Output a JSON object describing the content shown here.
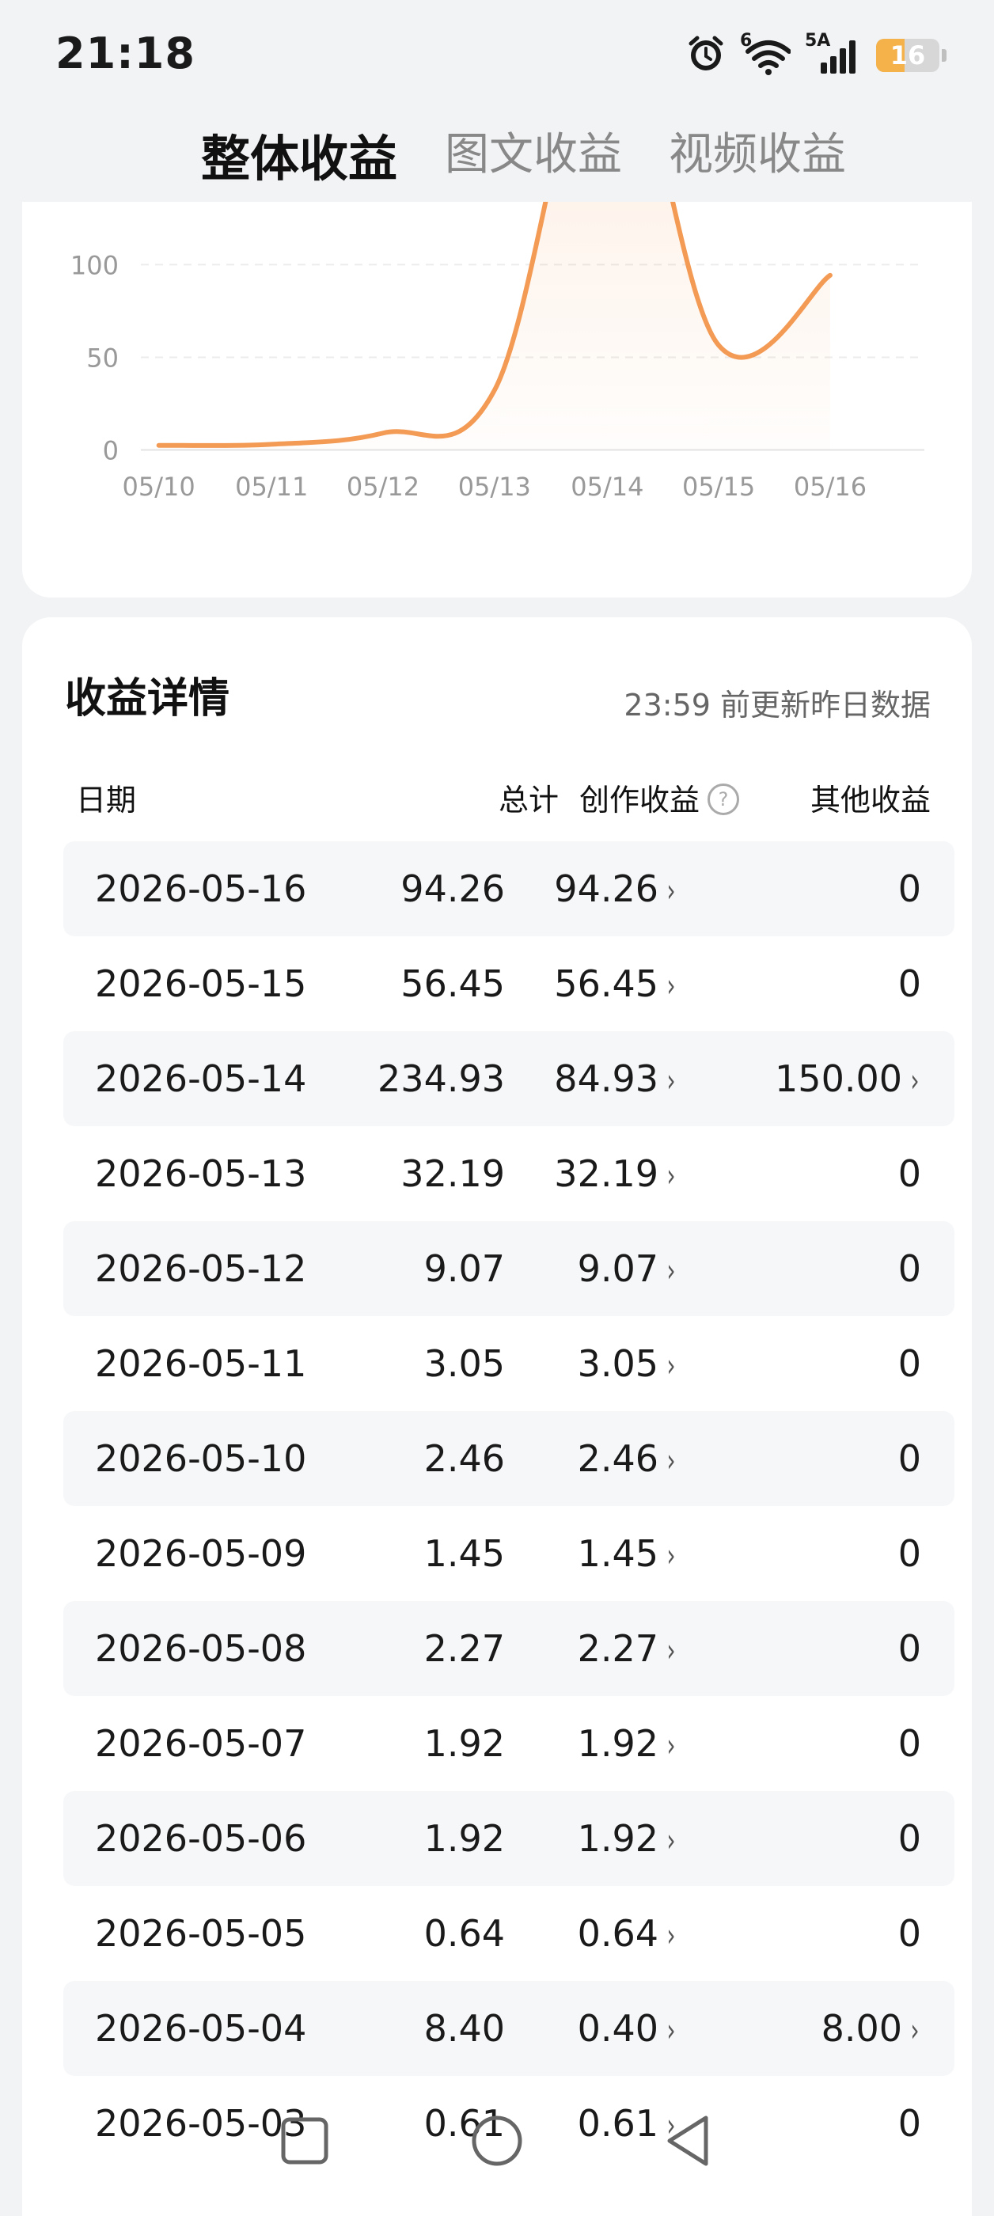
{
  "status_bar": {
    "time": "21:18",
    "icons": [
      "alarm-icon",
      "wifi-icon",
      "signal-5a-icon"
    ],
    "wifi_label": "6",
    "network_label": "5A",
    "battery_level": "16",
    "battery_color": "#f5b14a"
  },
  "tabs": [
    {
      "label": "整体收益",
      "active": true
    },
    {
      "label": "图文收益",
      "active": false
    },
    {
      "label": "视频收益",
      "active": false
    }
  ],
  "chart_data": {
    "type": "line",
    "categories": [
      "05/10",
      "05/11",
      "05/12",
      "05/13",
      "05/14",
      "05/15",
      "05/16"
    ],
    "values": [
      2.46,
      3.05,
      9.07,
      32.19,
      234.93,
      56.45,
      94.26
    ],
    "y_ticks": [
      "100",
      "50",
      "0"
    ],
    "ylim": [
      0,
      100
    ],
    "line_color": "#f39a55",
    "grid": true
  },
  "details": {
    "title": "收益详情",
    "note": "23:59 前更新昨日数据",
    "headers": {
      "date": "日期",
      "total": "总计",
      "creation": "创作收益",
      "other": "其他收益"
    },
    "rows": [
      {
        "date": "2026-05-16",
        "total": "94.26",
        "creation": "94.26",
        "other": "0"
      },
      {
        "date": "2026-05-15",
        "total": "56.45",
        "creation": "56.45",
        "other": "0"
      },
      {
        "date": "2026-05-14",
        "total": "234.93",
        "creation": "84.93",
        "other": "150.00"
      },
      {
        "date": "2026-05-13",
        "total": "32.19",
        "creation": "32.19",
        "other": "0"
      },
      {
        "date": "2026-05-12",
        "total": "9.07",
        "creation": "9.07",
        "other": "0"
      },
      {
        "date": "2026-05-11",
        "total": "3.05",
        "creation": "3.05",
        "other": "0"
      },
      {
        "date": "2026-05-10",
        "total": "2.46",
        "creation": "2.46",
        "other": "0"
      },
      {
        "date": "2026-05-09",
        "total": "1.45",
        "creation": "1.45",
        "other": "0"
      },
      {
        "date": "2026-05-08",
        "total": "2.27",
        "creation": "2.27",
        "other": "0"
      },
      {
        "date": "2026-05-07",
        "total": "1.92",
        "creation": "1.92",
        "other": "0"
      },
      {
        "date": "2026-05-06",
        "total": "1.92",
        "creation": "1.92",
        "other": "0"
      },
      {
        "date": "2026-05-05",
        "total": "0.64",
        "creation": "0.64",
        "other": "0"
      },
      {
        "date": "2026-05-04",
        "total": "8.40",
        "creation": "0.40",
        "other": "8.00"
      },
      {
        "date": "2026-05-03",
        "total": "0.61",
        "creation": "0.61",
        "other": "0"
      }
    ]
  },
  "nav_bar": {
    "buttons": [
      "recents-button",
      "home-button",
      "back-button"
    ]
  }
}
